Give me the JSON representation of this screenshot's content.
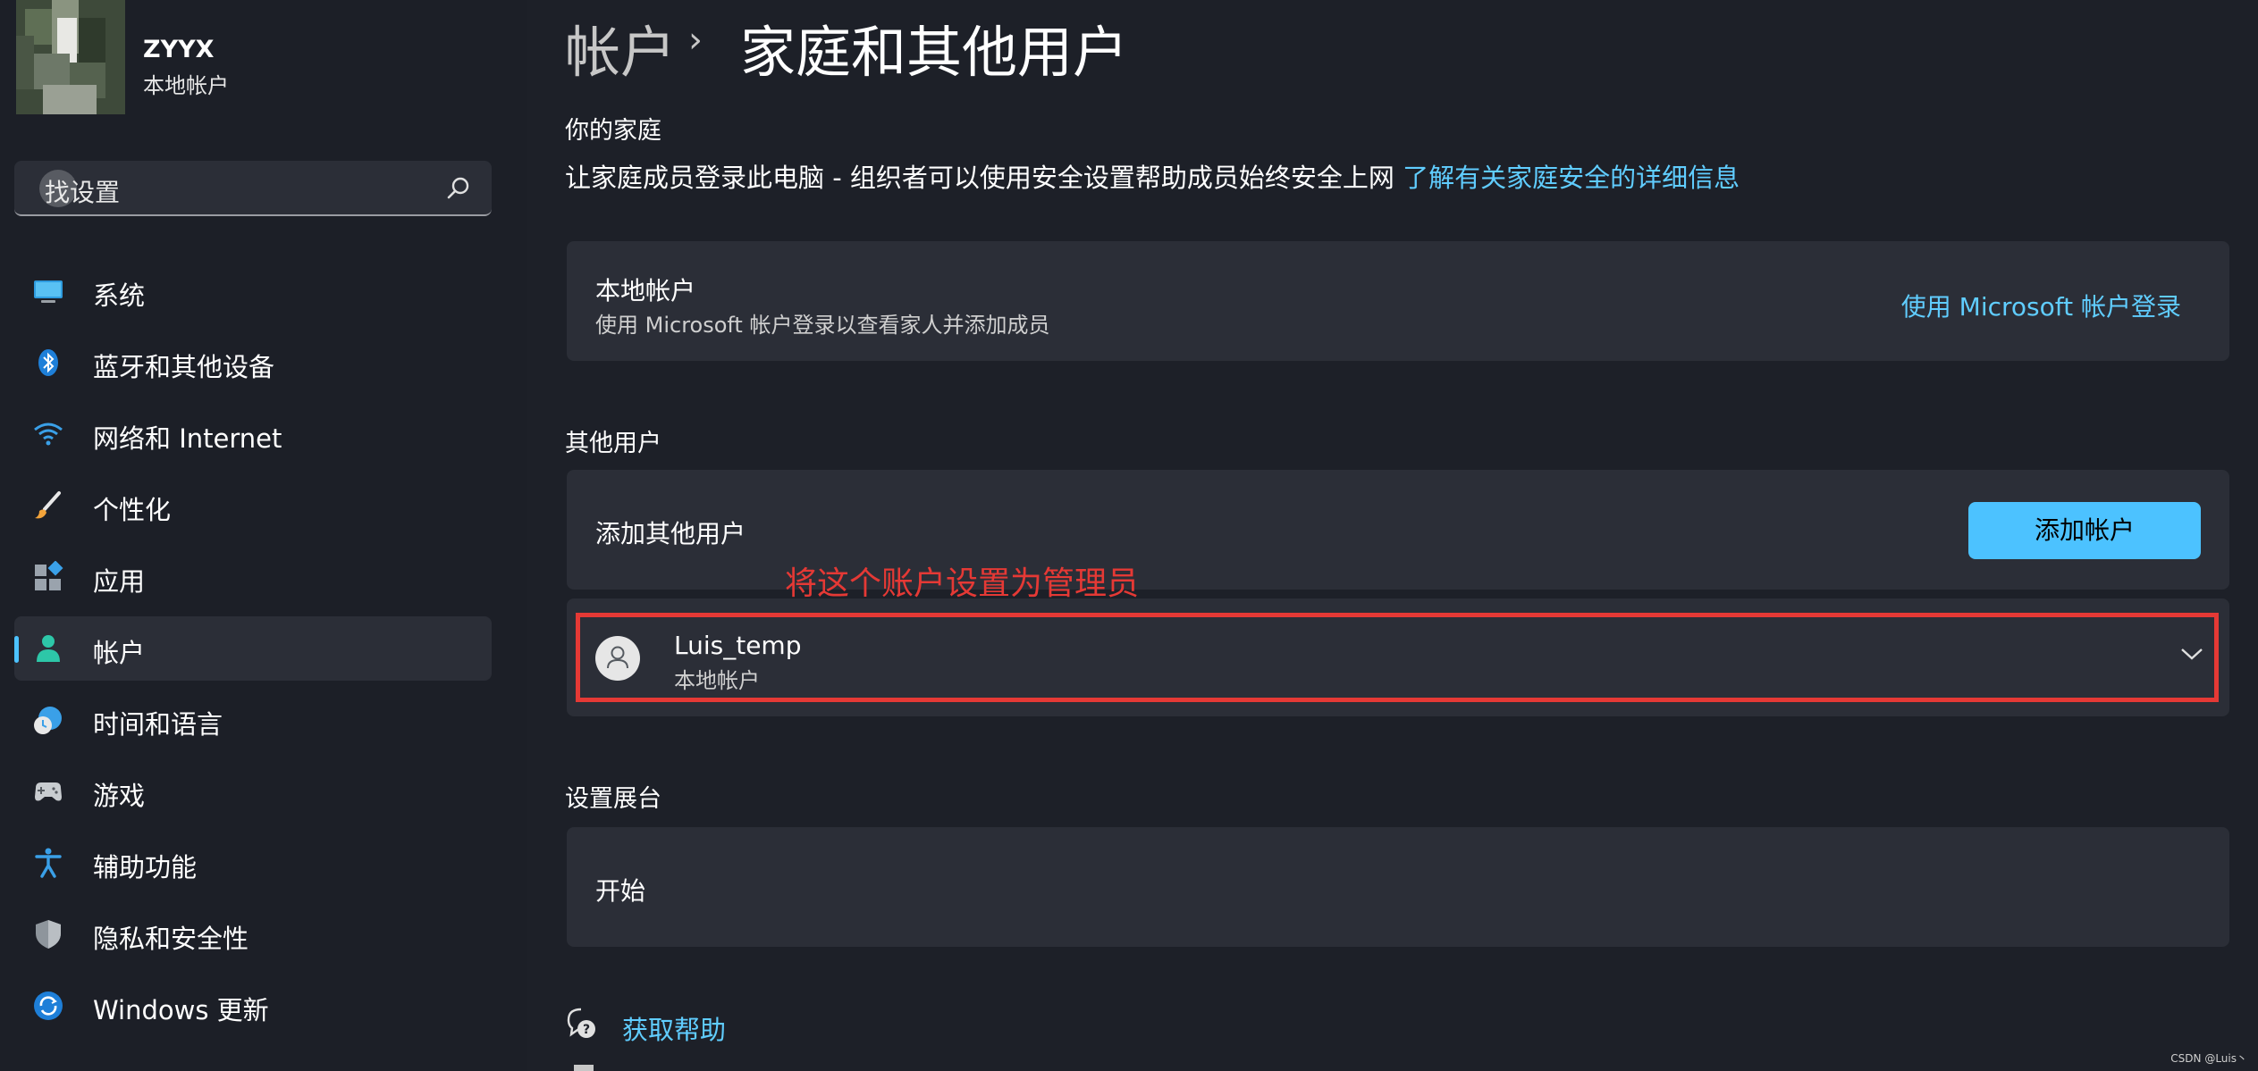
{
  "profile": {
    "name": "ZYYX",
    "account_type": "本地帐户"
  },
  "search": {
    "placeholder": "查找设置",
    "value_visible": "找设置"
  },
  "nav": [
    {
      "label": "系统",
      "icon": "monitor-icon"
    },
    {
      "label": "蓝牙和其他设备",
      "icon": "bluetooth-icon"
    },
    {
      "label": "网络和 Internet",
      "icon": "wifi-icon"
    },
    {
      "label": "个性化",
      "icon": "brush-icon"
    },
    {
      "label": "应用",
      "icon": "apps-icon"
    },
    {
      "label": "帐户",
      "icon": "person-icon",
      "active": true
    },
    {
      "label": "时间和语言",
      "icon": "clock-globe-icon"
    },
    {
      "label": "游戏",
      "icon": "gamepad-icon"
    },
    {
      "label": "辅助功能",
      "icon": "accessibility-icon"
    },
    {
      "label": "隐私和安全性",
      "icon": "shield-icon"
    },
    {
      "label": "Windows 更新",
      "icon": "update-icon"
    }
  ],
  "breadcrumb": {
    "parent": "帐户",
    "separator": "›",
    "current": "家庭和其他用户"
  },
  "family": {
    "heading": "你的家庭",
    "description": "让家庭成员登录此电脑 - 组织者可以使用安全设置帮助成员始终安全上网",
    "link": "了解有关家庭安全的详细信息"
  },
  "local_account_card": {
    "title": "本地帐户",
    "subtitle": "使用 Microsoft 帐户登录以查看家人并添加成员",
    "action": "使用 Microsoft 帐户登录"
  },
  "other_users": {
    "heading": "其他用户",
    "add_label": "添加其他用户",
    "add_button": "添加帐户",
    "annotation": "将这个账户设置为管理员",
    "user": {
      "name": "Luis_temp",
      "type": "本地帐户"
    }
  },
  "kiosk": {
    "heading": "设置展台",
    "action": "开始"
  },
  "help": {
    "label": "获取帮助"
  },
  "watermark": "CSDN @Luis丶",
  "colors": {
    "accent": "#4cc2ff",
    "link": "#60cdff",
    "annotation": "#e53935",
    "background": "#1d2028",
    "card": "#2b2e37"
  }
}
